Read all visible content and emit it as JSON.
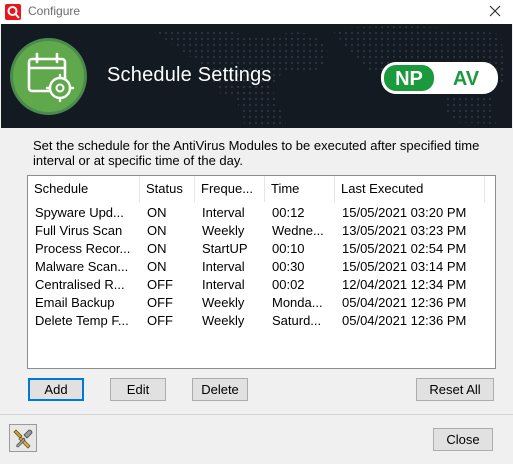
{
  "window": {
    "title": "Configure"
  },
  "banner": {
    "title": "Schedule Settings",
    "logo_left": "NP",
    "logo_right": "AV"
  },
  "description": "Set the schedule for the AntiVirus Modules to be executed after specified time interval or at specific time of the day.",
  "table": {
    "columns": [
      "Schedule",
      "Status",
      "Freque...",
      "Time",
      "Last Executed"
    ],
    "rows": [
      [
        "Spyware Upd...",
        "ON",
        "Interval",
        "00:12",
        "15/05/2021 03:20 PM"
      ],
      [
        "Full Virus Scan",
        "ON",
        "Weekly",
        "Wedne...",
        "13/05/2021 03:23 PM"
      ],
      [
        "Process Recor...",
        "ON",
        "StartUP",
        "00:10",
        "15/05/2021 02:54 PM"
      ],
      [
        "Malware Scan...",
        "ON",
        "Interval",
        "00:30",
        "15/05/2021 03:14 PM"
      ],
      [
        "Centralised R...",
        "OFF",
        "Interval",
        "00:02",
        "12/04/2021 12:34 PM"
      ],
      [
        "Email Backup",
        "OFF",
        "Weekly",
        "Monda...",
        "05/04/2021 12:36 PM"
      ],
      [
        "Delete Temp F...",
        "OFF",
        "Weekly",
        "Saturd...",
        "05/04/2021 12:36 PM"
      ]
    ]
  },
  "buttons": {
    "add": "Add",
    "edit": "Edit",
    "delete": "Delete",
    "reset_all": "Reset All",
    "close": "Close"
  },
  "colors": {
    "accent": "#0078d7",
    "banner_bg": "#141a22",
    "icon_green": "#5fa84b",
    "logo_green": "#1a9a3c",
    "app_red": "#e8141e"
  },
  "icons": {
    "app": "npav-app-icon",
    "close": "close-icon",
    "calendar": "calendar-gear-icon",
    "tool": "tools-icon"
  }
}
